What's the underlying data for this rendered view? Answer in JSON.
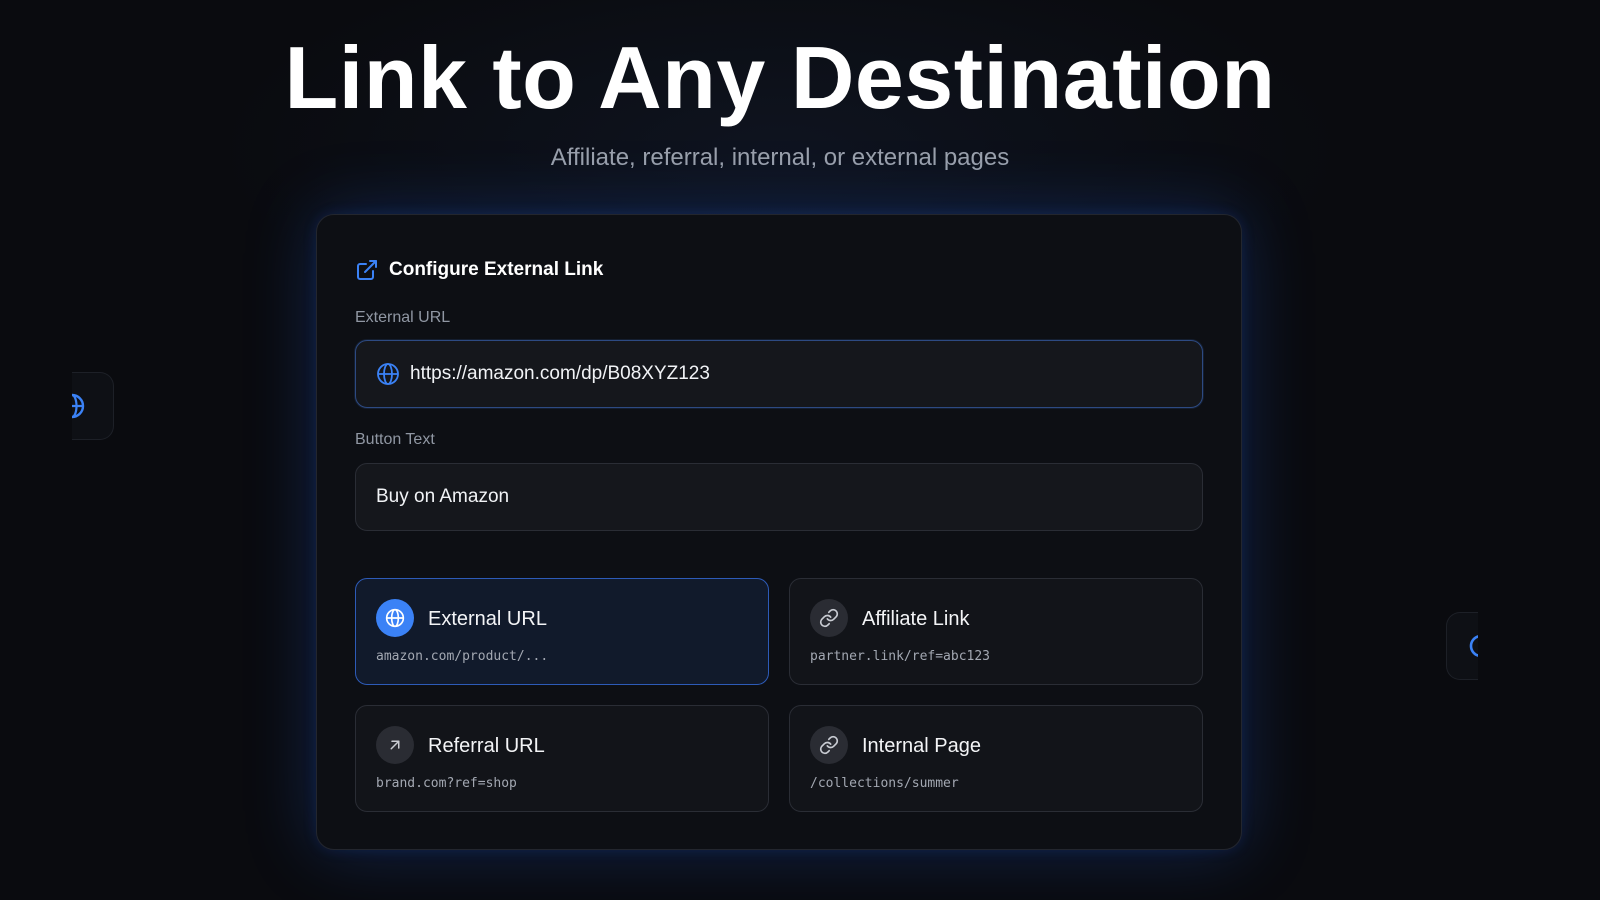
{
  "hero": {
    "title": "Link to Any Destination",
    "subtitle": "Affiliate, referral, internal, or external pages"
  },
  "card": {
    "header_icon": "external-link-icon",
    "title": "Configure External Link",
    "external_url": {
      "label": "External URL",
      "value": "https://amazon.com/dp/B08XYZ123",
      "icon": "globe-icon"
    },
    "button_text": {
      "label": "Button Text",
      "value": "Buy on Amazon"
    },
    "options": [
      {
        "title": "External URL",
        "subtitle": "amazon.com/product/...",
        "icon": "globe-icon",
        "selected": true
      },
      {
        "title": "Affiliate Link",
        "subtitle": "partner.link/ref=abc123",
        "icon": "link-icon",
        "selected": false
      },
      {
        "title": "Referral URL",
        "subtitle": "brand.com?ref=shop",
        "icon": "arrow-up-right-icon",
        "selected": false
      },
      {
        "title": "Internal Page",
        "subtitle": "/collections/summer",
        "icon": "link-icon",
        "selected": false
      }
    ]
  },
  "colors": {
    "accent": "#3b82f6",
    "background": "#0a0b0f",
    "card": "#0d0f14"
  }
}
